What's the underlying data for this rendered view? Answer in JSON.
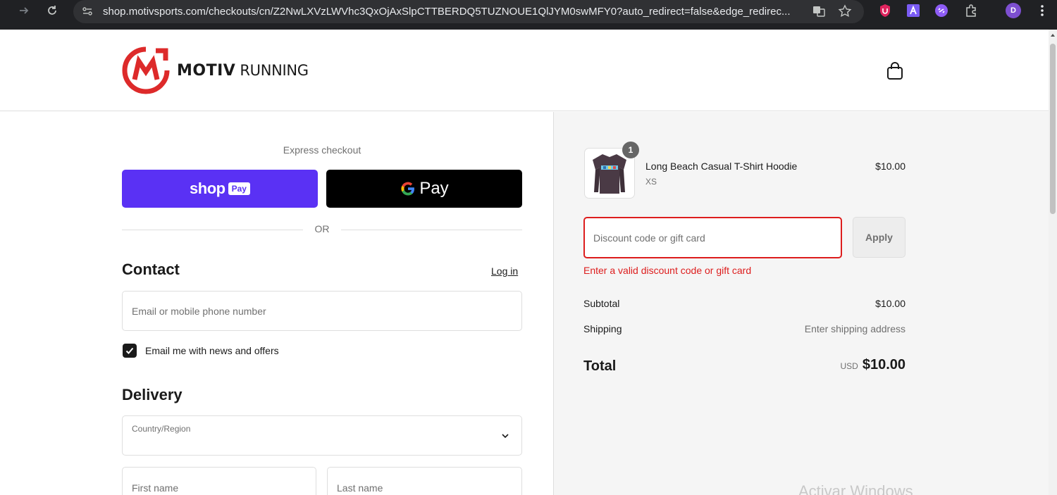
{
  "browser": {
    "url": "shop.motivsports.com/checkouts/cn/Z2NwLXVzLWVhc3QxOjAxSlpCTTBERDQ5TUZNOUE1QlJYM0swMFY0?auto_redirect=false&edge_redirec...",
    "profile_initial": "D"
  },
  "header": {
    "brand_bold": "MOTIV",
    "brand_light": "RUNNING"
  },
  "checkout": {
    "express_label": "Express checkout",
    "shop_pay_text": "shop",
    "shop_pay_badge": "Pay",
    "gpay_text": "Pay",
    "or_label": "OR",
    "contact_title": "Contact",
    "login_link": "Log in",
    "email_placeholder": "Email or mobile phone number",
    "newsletter_label": "Email me with news and offers",
    "newsletter_checked": true,
    "delivery_title": "Delivery",
    "country_label": "Country/Region",
    "first_name_placeholder": "First name",
    "last_name_placeholder": "Last name"
  },
  "summary": {
    "item": {
      "quantity": "1",
      "name": "Long Beach Casual T-Shirt Hoodie",
      "variant": "XS",
      "price": "$10.00"
    },
    "discount_placeholder": "Discount code or gift card",
    "apply_label": "Apply",
    "error_message": "Enter a valid discount code or gift card",
    "subtotal_label": "Subtotal",
    "subtotal_value": "$10.00",
    "shipping_label": "Shipping",
    "shipping_value": "Enter shipping address",
    "total_label": "Total",
    "total_currency": "USD",
    "total_value": "$10.00"
  },
  "overlay": {
    "watermark": "Activar Windows"
  },
  "colors": {
    "brand_red": "#dd2a2a",
    "shop_pay": "#5a31f4",
    "error": "#dd1d1d"
  }
}
